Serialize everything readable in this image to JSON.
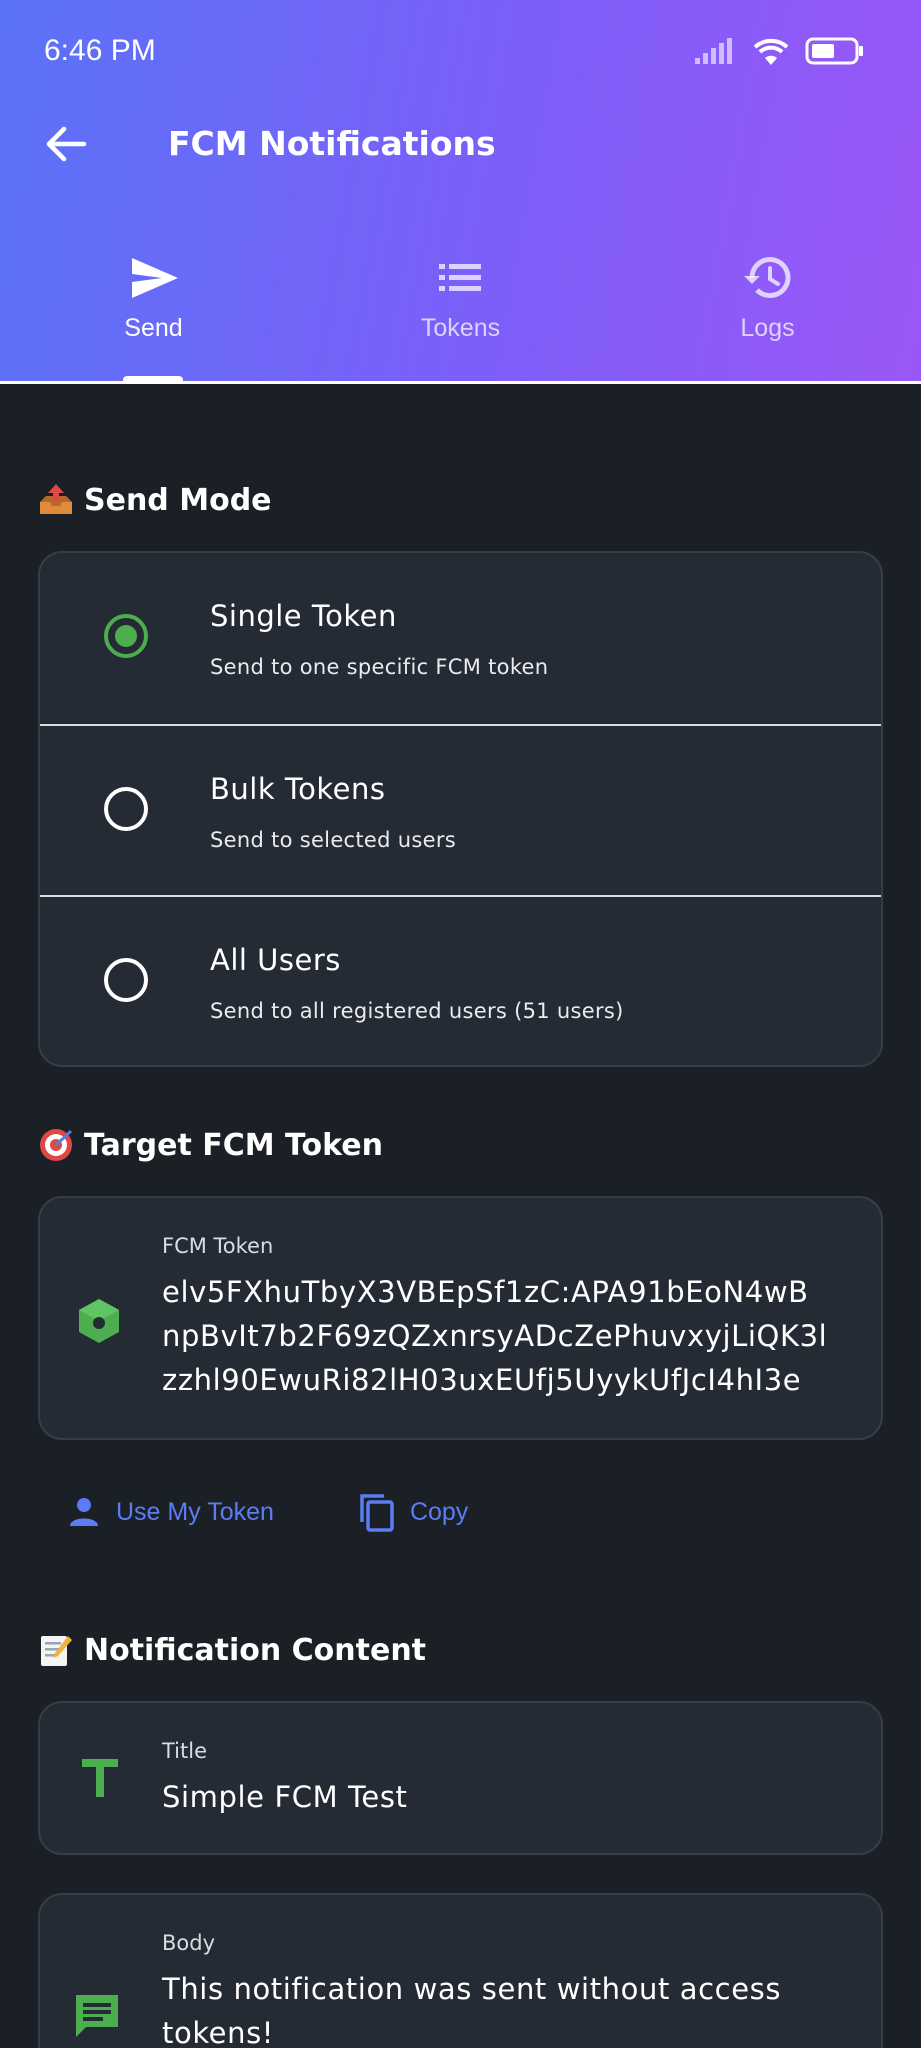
{
  "status_bar": {
    "time": "6:46 PM"
  },
  "app_bar": {
    "title": "FCM Notifications"
  },
  "tabs": [
    {
      "label": "Send",
      "icon": "send-icon",
      "active": true
    },
    {
      "label": "Tokens",
      "icon": "list-icon",
      "active": false
    },
    {
      "label": "Logs",
      "icon": "history-icon",
      "active": false
    }
  ],
  "send_mode": {
    "title": "Send Mode",
    "emoji": "outbox-tray-icon",
    "options": [
      {
        "label": "Single Token",
        "description": "Send to one specific FCM token",
        "selected": true
      },
      {
        "label": "Bulk Tokens",
        "description": "Send to selected users",
        "selected": false
      },
      {
        "label": "All Users",
        "description": "Send to all registered users (51 users)",
        "selected": false
      }
    ]
  },
  "target": {
    "title": "Target FCM Token",
    "emoji": "target-icon",
    "field_label": "FCM Token",
    "token_lines": [
      "elv5FXhuTbyX3VBEpSf1zC:APA91bEoN4wB",
      "npBvIt7b2F69zQZxnrsyADcZePhuvxyjLiQK3l",
      "zzhl90EwuRi82lH03uxEUfj5UyykUfJcI4hI3e"
    ],
    "use_my_token_label": "Use My Token",
    "copy_label": "Copy"
  },
  "content": {
    "title": "Notification Content",
    "emoji": "memo-icon",
    "title_field": {
      "label": "Title",
      "value": "Simple FCM Test"
    },
    "body_field": {
      "label": "Body",
      "value_lines": [
        "This notification was sent without access",
        "tokens!"
      ]
    }
  },
  "colors": {
    "accent_green": "#4cae4f",
    "link_blue": "#5b7cf4",
    "background": "#1b1f26",
    "card": "#252b35"
  }
}
